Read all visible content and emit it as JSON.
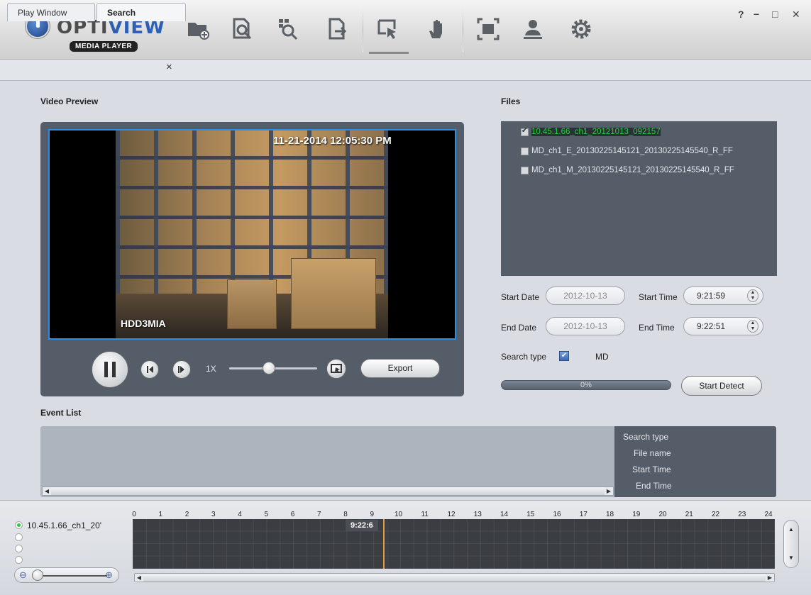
{
  "app": {
    "logo_text_a": "OPTI",
    "logo_text_b": "VIEW",
    "logo_sub": "MEDIA PLAYER",
    "window_controls": [
      "?",
      "−",
      "□",
      "✕"
    ]
  },
  "toolbar": {
    "icons": [
      "open-folder-icon",
      "search-file-icon",
      "smart-search-icon",
      "export-file-icon",
      "pointer-select-icon",
      "hand-icon",
      "fullscreen-icon",
      "user-icon",
      "settings-icon"
    ]
  },
  "tabs": {
    "play_window": "Play Window",
    "search": "Search",
    "close": "×"
  },
  "video": {
    "section_label": "Video Preview",
    "osd_timestamp": "11-21-2014 12:05:30 PM",
    "osd_camera": "HDD3MIA",
    "speed": "1X",
    "export_label": "Export",
    "speed_slider_level": 0.45
  },
  "files": {
    "section_label": "Files",
    "items": [
      {
        "name": "10.45.1.66_ch1_20121013_092157",
        "checked": true
      },
      {
        "name": "MD_ch1_E_20130225145121_20130225145540_R_FF",
        "checked": false
      },
      {
        "name": "MD_ch1_M_20130225145121_20130225145540_R_FF",
        "checked": false
      }
    ]
  },
  "search_form": {
    "start_date_label": "Start Date",
    "start_date": "2012-10-13",
    "start_time_label": "Start Time",
    "start_time": "9:21:59",
    "end_date_label": "End Date",
    "end_date": "2012-10-13",
    "end_time_label": "End Time",
    "end_time": "9:22:51",
    "search_type_label": "Search type",
    "search_type_value": "MD",
    "search_type_checked": true,
    "progress": "0%",
    "detect_label": "Start Detect"
  },
  "event_list": {
    "section_label": "Event List",
    "columns": [
      "Search type",
      "File name",
      "Start Time",
      "End Time"
    ]
  },
  "timeline": {
    "channel": "10.45.1.66_ch1_20'",
    "hours": [
      "0",
      "1",
      "2",
      "3",
      "4",
      "5",
      "6",
      "7",
      "8",
      "9",
      "10",
      "11",
      "12",
      "13",
      "14",
      "15",
      "16",
      "17",
      "18",
      "19",
      "20",
      "21",
      "22",
      "23",
      "24"
    ],
    "cursor_time": "9:22:6"
  },
  "colors": {
    "accent": "#2c8ee0",
    "panel": "#555d69",
    "selected_file": "#26d23e",
    "cursor": "#e39a3a"
  }
}
